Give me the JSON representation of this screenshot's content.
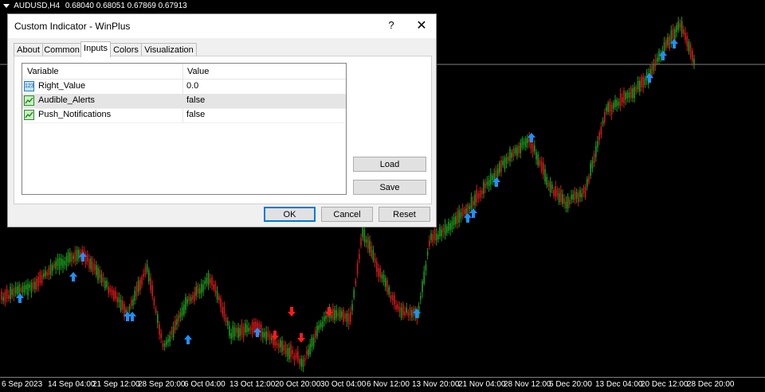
{
  "chart_header": {
    "symbol": "AUDUSD,H4",
    "ohlc": "0.68040 0.68051 0.67869 0.67913"
  },
  "time_axis": [
    "6 Sep 2023",
    "14 Sep 04:00",
    "21 Sep 12:00",
    "28 Sep 20:00",
    "6 Oct 04:00",
    "13 Oct 12:00",
    "20 Oct 20:00",
    "30 Oct 04:00",
    "6 Nov 12:00",
    "13 Nov 20:00",
    "21 Nov 04:00",
    "28 Nov 12:00",
    "5 Dec 20:00",
    "13 Dec 04:00",
    "20 Dec 12:00",
    "28 Dec 20:00"
  ],
  "colors": {
    "bull": "#1e9b1e",
    "bear": "#d11a1a",
    "buy_arrow": "#1e90ff",
    "sell_arrow": "#ff1a1a",
    "bg": "#000000"
  },
  "dialog": {
    "title": "Custom Indicator - WinPlus",
    "help_glyph": "?",
    "close_glyph": "✕",
    "tabs": [
      {
        "label": "About"
      },
      {
        "label": "Common"
      },
      {
        "label": "Inputs"
      },
      {
        "label": "Colors"
      },
      {
        "label": "Visualization"
      }
    ],
    "active_tab": "Inputs",
    "columns": {
      "variable": "Variable",
      "value": "Value"
    },
    "inputs": [
      {
        "icon": "number-icon",
        "icon_text": "123",
        "name": "Right_Value",
        "value": "0.0"
      },
      {
        "icon": "flag-icon",
        "icon_text": "",
        "name": "Audible_Alerts",
        "value": "false"
      },
      {
        "icon": "flag-icon",
        "icon_text": "",
        "name": "Push_Notifications",
        "value": "false"
      }
    ],
    "buttons": {
      "load": "Load",
      "save": "Save",
      "ok": "OK",
      "cancel": "Cancel",
      "reset": "Reset"
    }
  }
}
